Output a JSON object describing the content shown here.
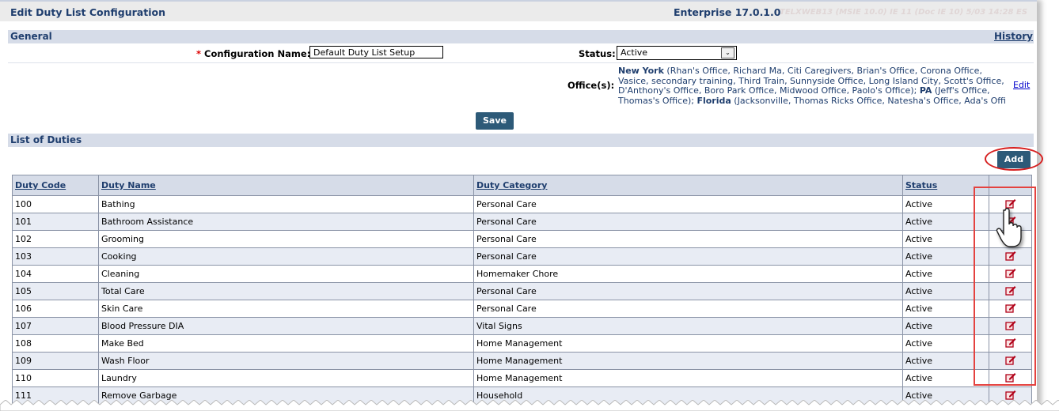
{
  "header": {
    "title": "Edit Duty List Configuration",
    "version": "Enterprise 17.0.1.0",
    "environment": "TELXWEB13 (MSIE 10.0) IE 11 (Doc IE 10) 5/03 14:28 ES"
  },
  "general": {
    "section_title": "General",
    "history_link": "History",
    "config_name_label": "Configuration Name:",
    "required_marker": "*",
    "config_name_value": "Default Duty List Setup",
    "status_label": "Status:",
    "status_value": "Active",
    "offices_label": "Office(s):",
    "offices": [
      {
        "state": "New York",
        "list": " (Rhan's Office, Richard Ma, Citi Caregivers, Brian's Office, Corona Office, Vasice, secondary training, Third Train, Sunnyside Office, Long Island City, Scott's Office, D'Anthony's Office, Boro Park Office, Midwood Office, Paolo's Office); "
      },
      {
        "state": "PA",
        "list": " (Jeff's Office, Thomas's Office); "
      },
      {
        "state": "Florida",
        "list": " (Jacksonville, Thomas Ricks Office, Natesha's Office, Ada's Offi"
      }
    ],
    "edit_link": "Edit",
    "save_label": "Save"
  },
  "duties": {
    "section_title": "List of Duties",
    "add_label": "Add",
    "columns": [
      "Duty Code",
      "Duty Name",
      "Duty Category",
      "Status"
    ],
    "rows": [
      [
        "100",
        "Bathing",
        "Personal Care",
        "Active"
      ],
      [
        "101",
        "Bathroom Assistance",
        "Personal Care",
        "Active"
      ],
      [
        "102",
        "Grooming",
        "Personal Care",
        "Active"
      ],
      [
        "103",
        "Cooking",
        "Personal Care",
        "Active"
      ],
      [
        "104",
        "Cleaning",
        "Homemaker Chore",
        "Active"
      ],
      [
        "105",
        "Total Care",
        "Personal Care",
        "Active"
      ],
      [
        "106",
        "Skin Care",
        "Personal Care",
        "Active"
      ],
      [
        "107",
        "Blood Pressure DIA",
        "Vital Signs",
        "Active"
      ],
      [
        "108",
        "Make Bed",
        "Home Management",
        "Active"
      ],
      [
        "109",
        "Wash Floor",
        "Home Management",
        "Active"
      ],
      [
        "110",
        "Laundry",
        "Home Management",
        "Active"
      ],
      [
        "111",
        "Remove Garbage",
        "Household",
        "Active"
      ]
    ],
    "row_action_icon": "edit-icon"
  },
  "colors": {
    "accent": "#1f3e6e",
    "button": "#2d5a78",
    "highlight": "#e4423f"
  }
}
